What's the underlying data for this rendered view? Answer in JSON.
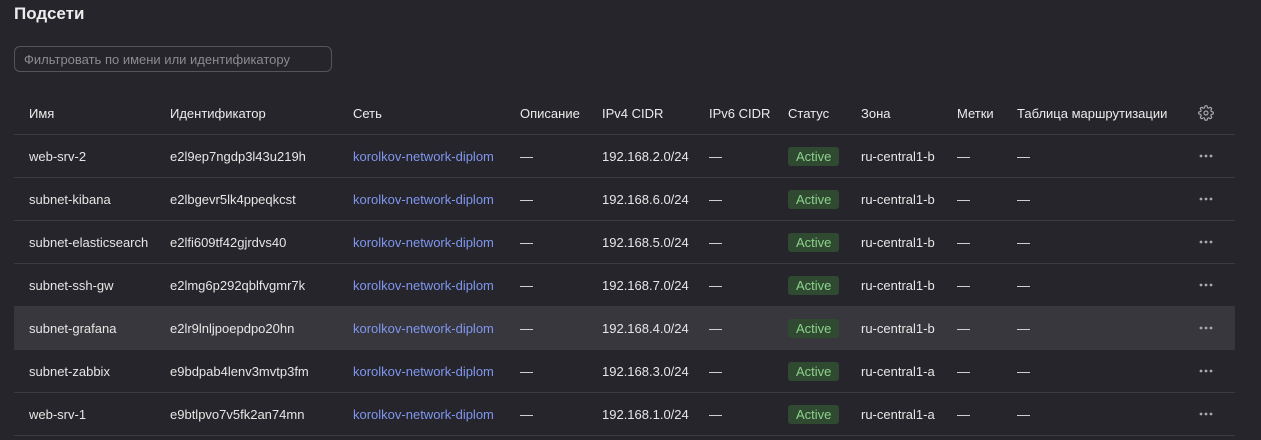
{
  "page": {
    "title": "Подсети"
  },
  "filter": {
    "placeholder": "Фильтровать по имени или идентификатору",
    "value": ""
  },
  "table": {
    "columns": {
      "name": "Имя",
      "id": "Идентификатор",
      "network": "Сеть",
      "description": "Описание",
      "ipv4": "IPv4 CIDR",
      "ipv6": "IPv6 CIDR",
      "status": "Статус",
      "zone": "Зона",
      "labels": "Метки",
      "route_table": "Таблица маршрутизации"
    },
    "settings_icon": "gear-icon",
    "row_action_icon": "more-horizontal-icon",
    "status_color": "#8cd18c",
    "status_bg": "#2f4a30",
    "link_color": "#7f96ef",
    "rows": [
      {
        "name": "web-srv-2",
        "id": "e2l9ep7ngdp3l43u219h",
        "network": "korolkov-network-diplom",
        "description": "—",
        "ipv4": "192.168.2.0/24",
        "ipv6": "—",
        "status": "Active",
        "zone": "ru-central1-b",
        "labels": "—",
        "route_table": "—"
      },
      {
        "name": "subnet-kibana",
        "id": "e2lbgevr5lk4ppeqkcst",
        "network": "korolkov-network-diplom",
        "description": "—",
        "ipv4": "192.168.6.0/24",
        "ipv6": "—",
        "status": "Active",
        "zone": "ru-central1-b",
        "labels": "—",
        "route_table": "—"
      },
      {
        "name": "subnet-elasticsearch",
        "id": "e2lfi609tf42gjrdvs40",
        "network": "korolkov-network-diplom",
        "description": "—",
        "ipv4": "192.168.5.0/24",
        "ipv6": "—",
        "status": "Active",
        "zone": "ru-central1-b",
        "labels": "—",
        "route_table": "—"
      },
      {
        "name": "subnet-ssh-gw",
        "id": "e2lmg6p292qblfvgmr7k",
        "network": "korolkov-network-diplom",
        "description": "—",
        "ipv4": "192.168.7.0/24",
        "ipv6": "—",
        "status": "Active",
        "zone": "ru-central1-b",
        "labels": "—",
        "route_table": "—"
      },
      {
        "name": "subnet-grafana",
        "id": "e2lr9lnljpoepdpo20hn",
        "network": "korolkov-network-diplom",
        "description": "—",
        "ipv4": "192.168.4.0/24",
        "ipv6": "—",
        "status": "Active",
        "zone": "ru-central1-b",
        "labels": "—",
        "route_table": "—",
        "selected": true
      },
      {
        "name": "subnet-zabbix",
        "id": "e9bdpab4lenv3mvtp3fm",
        "network": "korolkov-network-diplom",
        "description": "—",
        "ipv4": "192.168.3.0/24",
        "ipv6": "—",
        "status": "Active",
        "zone": "ru-central1-a",
        "labels": "—",
        "route_table": "—"
      },
      {
        "name": "web-srv-1",
        "id": "e9btlpvo7v5fk2an74mn",
        "network": "korolkov-network-diplom",
        "description": "—",
        "ipv4": "192.168.1.0/24",
        "ipv6": "—",
        "status": "Active",
        "zone": "ru-central1-a",
        "labels": "—",
        "route_table": "—"
      }
    ]
  }
}
